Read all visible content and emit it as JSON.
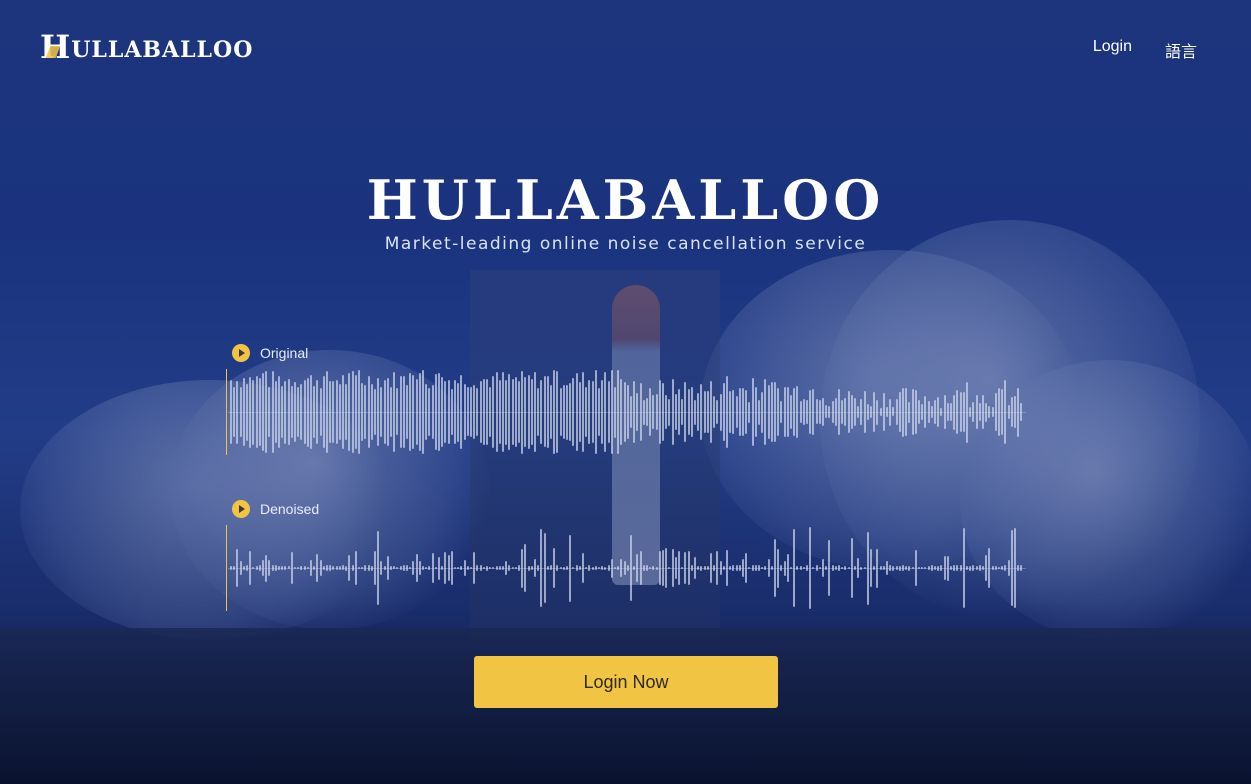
{
  "brand": {
    "logo_initial": "H",
    "logo_rest": "ULLABALLOO",
    "hero_title": "HULLABALLOO",
    "tagline": "Market-leading online noise cancellation service"
  },
  "nav": {
    "login_label": "Login",
    "language_label": "語言"
  },
  "players": [
    {
      "label": "Original",
      "icon": "play-icon"
    },
    {
      "label": "Denoised",
      "icon": "play-icon"
    }
  ],
  "cta": {
    "label": "Login Now"
  },
  "colors": {
    "accent": "#f2c443",
    "background": "#1f3a88",
    "waveform": "#cdd6ec",
    "cta_text": "#2e2a1e"
  }
}
